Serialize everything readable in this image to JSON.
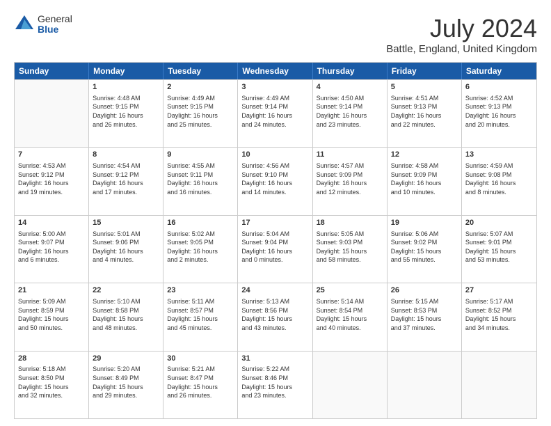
{
  "logo": {
    "general": "General",
    "blue": "Blue"
  },
  "title": "July 2024",
  "subtitle": "Battle, England, United Kingdom",
  "header_days": [
    "Sunday",
    "Monday",
    "Tuesday",
    "Wednesday",
    "Thursday",
    "Friday",
    "Saturday"
  ],
  "weeks": [
    [
      {
        "date": "",
        "info": ""
      },
      {
        "date": "1",
        "info": "Sunrise: 4:48 AM\nSunset: 9:15 PM\nDaylight: 16 hours\nand 26 minutes."
      },
      {
        "date": "2",
        "info": "Sunrise: 4:49 AM\nSunset: 9:15 PM\nDaylight: 16 hours\nand 25 minutes."
      },
      {
        "date": "3",
        "info": "Sunrise: 4:49 AM\nSunset: 9:14 PM\nDaylight: 16 hours\nand 24 minutes."
      },
      {
        "date": "4",
        "info": "Sunrise: 4:50 AM\nSunset: 9:14 PM\nDaylight: 16 hours\nand 23 minutes."
      },
      {
        "date": "5",
        "info": "Sunrise: 4:51 AM\nSunset: 9:13 PM\nDaylight: 16 hours\nand 22 minutes."
      },
      {
        "date": "6",
        "info": "Sunrise: 4:52 AM\nSunset: 9:13 PM\nDaylight: 16 hours\nand 20 minutes."
      }
    ],
    [
      {
        "date": "7",
        "info": "Sunrise: 4:53 AM\nSunset: 9:12 PM\nDaylight: 16 hours\nand 19 minutes."
      },
      {
        "date": "8",
        "info": "Sunrise: 4:54 AM\nSunset: 9:12 PM\nDaylight: 16 hours\nand 17 minutes."
      },
      {
        "date": "9",
        "info": "Sunrise: 4:55 AM\nSunset: 9:11 PM\nDaylight: 16 hours\nand 16 minutes."
      },
      {
        "date": "10",
        "info": "Sunrise: 4:56 AM\nSunset: 9:10 PM\nDaylight: 16 hours\nand 14 minutes."
      },
      {
        "date": "11",
        "info": "Sunrise: 4:57 AM\nSunset: 9:09 PM\nDaylight: 16 hours\nand 12 minutes."
      },
      {
        "date": "12",
        "info": "Sunrise: 4:58 AM\nSunset: 9:09 PM\nDaylight: 16 hours\nand 10 minutes."
      },
      {
        "date": "13",
        "info": "Sunrise: 4:59 AM\nSunset: 9:08 PM\nDaylight: 16 hours\nand 8 minutes."
      }
    ],
    [
      {
        "date": "14",
        "info": "Sunrise: 5:00 AM\nSunset: 9:07 PM\nDaylight: 16 hours\nand 6 minutes."
      },
      {
        "date": "15",
        "info": "Sunrise: 5:01 AM\nSunset: 9:06 PM\nDaylight: 16 hours\nand 4 minutes."
      },
      {
        "date": "16",
        "info": "Sunrise: 5:02 AM\nSunset: 9:05 PM\nDaylight: 16 hours\nand 2 minutes."
      },
      {
        "date": "17",
        "info": "Sunrise: 5:04 AM\nSunset: 9:04 PM\nDaylight: 16 hours\nand 0 minutes."
      },
      {
        "date": "18",
        "info": "Sunrise: 5:05 AM\nSunset: 9:03 PM\nDaylight: 15 hours\nand 58 minutes."
      },
      {
        "date": "19",
        "info": "Sunrise: 5:06 AM\nSunset: 9:02 PM\nDaylight: 15 hours\nand 55 minutes."
      },
      {
        "date": "20",
        "info": "Sunrise: 5:07 AM\nSunset: 9:01 PM\nDaylight: 15 hours\nand 53 minutes."
      }
    ],
    [
      {
        "date": "21",
        "info": "Sunrise: 5:09 AM\nSunset: 8:59 PM\nDaylight: 15 hours\nand 50 minutes."
      },
      {
        "date": "22",
        "info": "Sunrise: 5:10 AM\nSunset: 8:58 PM\nDaylight: 15 hours\nand 48 minutes."
      },
      {
        "date": "23",
        "info": "Sunrise: 5:11 AM\nSunset: 8:57 PM\nDaylight: 15 hours\nand 45 minutes."
      },
      {
        "date": "24",
        "info": "Sunrise: 5:13 AM\nSunset: 8:56 PM\nDaylight: 15 hours\nand 43 minutes."
      },
      {
        "date": "25",
        "info": "Sunrise: 5:14 AM\nSunset: 8:54 PM\nDaylight: 15 hours\nand 40 minutes."
      },
      {
        "date": "26",
        "info": "Sunrise: 5:15 AM\nSunset: 8:53 PM\nDaylight: 15 hours\nand 37 minutes."
      },
      {
        "date": "27",
        "info": "Sunrise: 5:17 AM\nSunset: 8:52 PM\nDaylight: 15 hours\nand 34 minutes."
      }
    ],
    [
      {
        "date": "28",
        "info": "Sunrise: 5:18 AM\nSunset: 8:50 PM\nDaylight: 15 hours\nand 32 minutes."
      },
      {
        "date": "29",
        "info": "Sunrise: 5:20 AM\nSunset: 8:49 PM\nDaylight: 15 hours\nand 29 minutes."
      },
      {
        "date": "30",
        "info": "Sunrise: 5:21 AM\nSunset: 8:47 PM\nDaylight: 15 hours\nand 26 minutes."
      },
      {
        "date": "31",
        "info": "Sunrise: 5:22 AM\nSunset: 8:46 PM\nDaylight: 15 hours\nand 23 minutes."
      },
      {
        "date": "",
        "info": ""
      },
      {
        "date": "",
        "info": ""
      },
      {
        "date": "",
        "info": ""
      }
    ]
  ]
}
